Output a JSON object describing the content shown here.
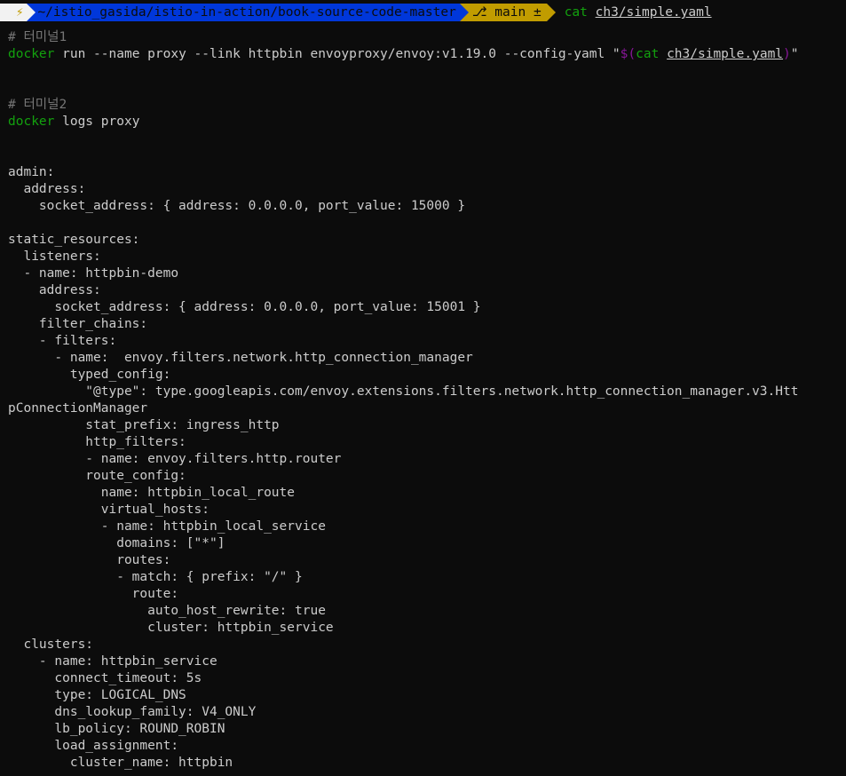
{
  "prompt": {
    "bolt_icon": "lightning-icon",
    "path": "~/istio_gasida/istio-in-action/book-source-code-master",
    "git_branch_icon": "branch-icon",
    "git_branch": "main ±",
    "command": "cat",
    "command_arg": "ch3/simple.yaml"
  },
  "comment1": "# 터미널1",
  "cmd1": {
    "bin": "docker",
    "args": " run --name proxy --link httpbin envoyproxy/envoy:v1.19.0 --config-yaml \"",
    "subst_open": "$(",
    "subst_cmd": "cat",
    "subst_arg": "ch3/simple.yaml",
    "subst_close": ")",
    "quote_close": "\""
  },
  "comment2": "# 터미널2",
  "cmd2": {
    "bin": "docker",
    "args": " logs proxy"
  },
  "yaml_lines": [
    "admin:",
    "  address:",
    "    socket_address: { address: 0.0.0.0, port_value: 15000 }",
    "",
    "static_resources:",
    "  listeners:",
    "  - name: httpbin-demo",
    "    address:",
    "      socket_address: { address: 0.0.0.0, port_value: 15001 }",
    "    filter_chains:",
    "    - filters:",
    "      - name:  envoy.filters.network.http_connection_manager",
    "        typed_config:",
    "          \"@type\": type.googleapis.com/envoy.extensions.filters.network.http_connection_manager.v3.Htt",
    "pConnectionManager",
    "          stat_prefix: ingress_http",
    "          http_filters:",
    "          - name: envoy.filters.http.router",
    "          route_config:",
    "            name: httpbin_local_route",
    "            virtual_hosts:",
    "            - name: httpbin_local_service",
    "              domains: [\"*\"]",
    "              routes:",
    "              - match: { prefix: \"/\" }",
    "                route:",
    "                  auto_host_rewrite: true",
    "                  cluster: httpbin_service",
    "  clusters:",
    "    - name: httpbin_service",
    "      connect_timeout: 5s",
    "      type: LOGICAL_DNS",
    "      dns_lookup_family: V4_ONLY",
    "      lb_policy: ROUND_ROBIN",
    "      load_assignment:",
    "        cluster_name: httpbin"
  ],
  "colors": {
    "background": "#0c0c0c",
    "text": "#cccccc",
    "green": "#13a10e",
    "path_segment": "#0037da",
    "git_segment": "#c19c00",
    "comment": "#767676",
    "purple": "#881798"
  }
}
